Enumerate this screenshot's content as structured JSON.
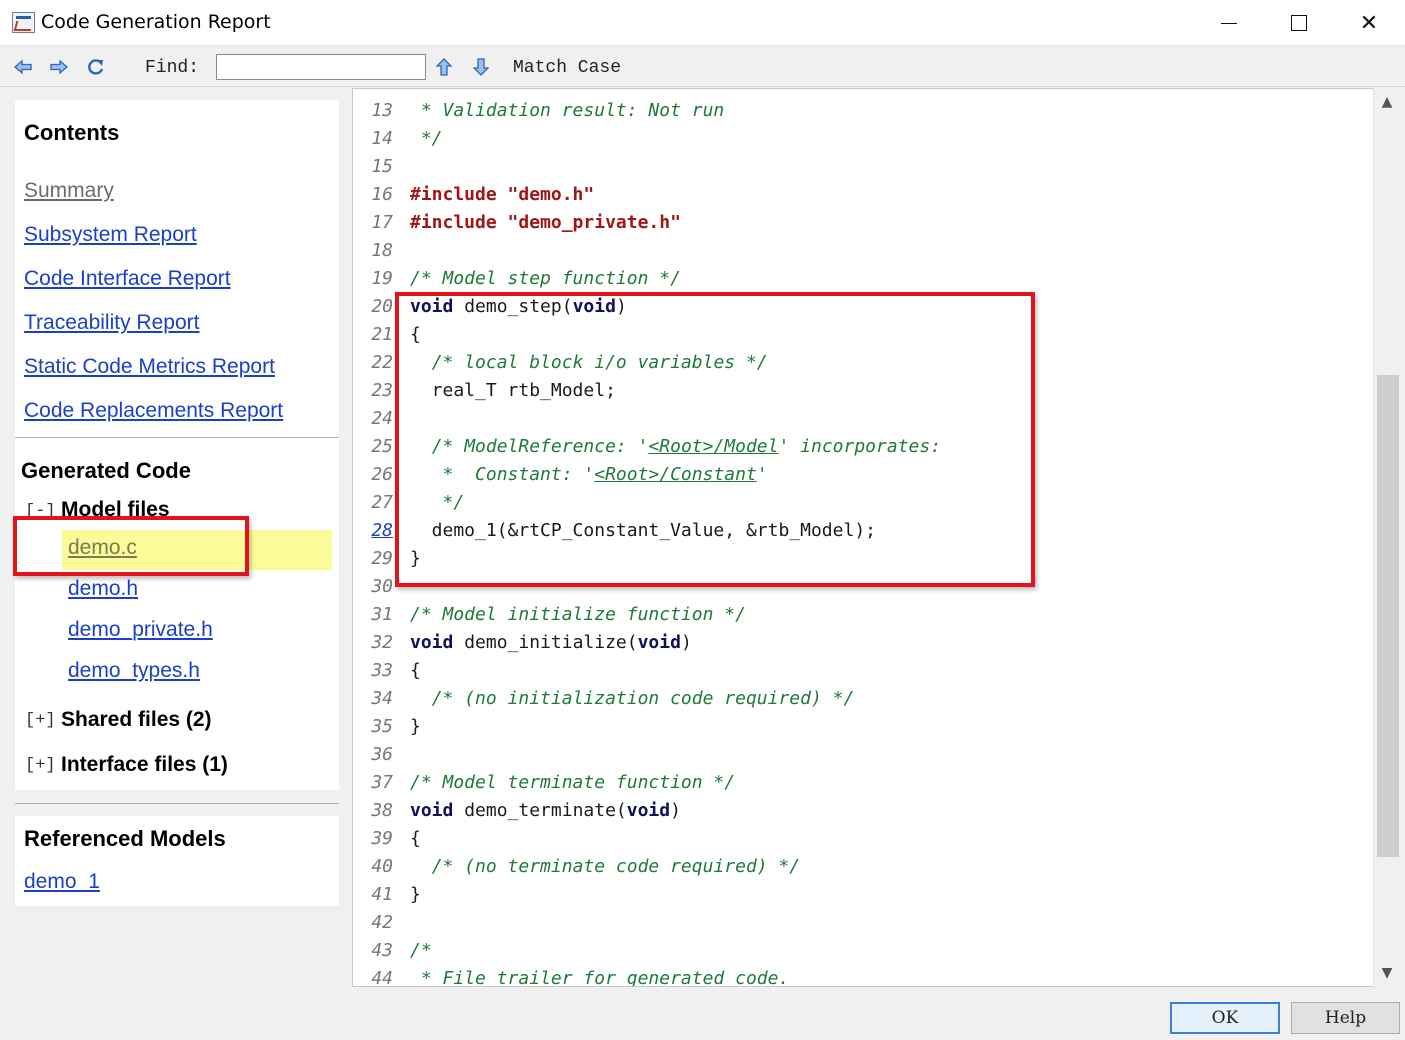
{
  "window": {
    "title": "Code Generation Report",
    "minimize": "minimize",
    "maximize": "maximize",
    "close": "✕"
  },
  "toolbar": {
    "back_icon": "back-arrow-icon",
    "forward_icon": "forward-arrow-icon",
    "refresh_icon": "refresh-icon",
    "find_label": "Find:",
    "find_value": "",
    "find_prev_icon": "up-arrow-icon",
    "find_next_icon": "down-arrow-icon",
    "match_case": "Match Case"
  },
  "sidebar": {
    "contents_title": "Contents",
    "contents_links": [
      "Summary",
      "Subsystem Report",
      "Code Interface Report",
      "Traceability Report",
      "Static Code Metrics Report",
      "Code Replacements Report"
    ],
    "generated_title": "Generated Code",
    "model_files_toggle": "[-]",
    "model_files_label": "Model files",
    "model_files": [
      "demo.c",
      "demo.h",
      "demo_private.h",
      "demo_types.h"
    ],
    "shared_toggle": "[+]",
    "shared_label": "Shared files (2)",
    "interface_toggle": "[+]",
    "interface_label": "Interface files (1)",
    "ref_title": "Referenced Models",
    "ref_links": [
      "demo_1"
    ]
  },
  "code": {
    "lines": [
      {
        "n": "13",
        "segs": [
          {
            "t": " * Validation result: Not run",
            "c": "cm"
          }
        ]
      },
      {
        "n": "14",
        "segs": [
          {
            "t": " */",
            "c": "cm"
          }
        ]
      },
      {
        "n": "15",
        "segs": []
      },
      {
        "n": "16",
        "segs": [
          {
            "t": "#include \"demo.h\"",
            "c": "pp"
          }
        ]
      },
      {
        "n": "17",
        "segs": [
          {
            "t": "#include \"demo_private.h\"",
            "c": "pp"
          }
        ]
      },
      {
        "n": "18",
        "segs": []
      },
      {
        "n": "19",
        "segs": [
          {
            "t": "/* Model step function */",
            "c": "cm"
          }
        ]
      },
      {
        "n": "20",
        "segs": [
          {
            "t": "void",
            "c": "kw"
          },
          {
            "t": " demo_step(",
            "c": ""
          },
          {
            "t": "void",
            "c": "kw"
          },
          {
            "t": ")",
            "c": ""
          }
        ]
      },
      {
        "n": "21",
        "segs": [
          {
            "t": "{",
            "c": ""
          }
        ]
      },
      {
        "n": "22",
        "segs": [
          {
            "t": "  ",
            "c": ""
          },
          {
            "t": "/* local block i/o variables */",
            "c": "cm"
          }
        ]
      },
      {
        "n": "23",
        "segs": [
          {
            "t": "  real_T rtb_Model;",
            "c": ""
          }
        ]
      },
      {
        "n": "24",
        "segs": []
      },
      {
        "n": "25",
        "segs": [
          {
            "t": "  ",
            "c": ""
          },
          {
            "t": "/* ModelReference: '",
            "c": "cm"
          },
          {
            "t": "<Root>/Model",
            "c": "cm-link"
          },
          {
            "t": "' incorporates:",
            "c": "cm"
          }
        ]
      },
      {
        "n": "26",
        "segs": [
          {
            "t": "   ",
            "c": ""
          },
          {
            "t": "*  Constant: '",
            "c": "cm"
          },
          {
            "t": "<Root>/Constant",
            "c": "cm-link"
          },
          {
            "t": "'",
            "c": "cm"
          }
        ]
      },
      {
        "n": "27",
        "segs": [
          {
            "t": "   ",
            "c": ""
          },
          {
            "t": "*/",
            "c": "cm"
          }
        ]
      },
      {
        "n": "28",
        "link": true,
        "segs": [
          {
            "t": "  demo_1(&rtCP_Constant_Value, &rtb_Model);",
            "c": ""
          }
        ]
      },
      {
        "n": "29",
        "segs": [
          {
            "t": "}",
            "c": ""
          }
        ]
      },
      {
        "n": "30",
        "segs": []
      },
      {
        "n": "31",
        "segs": [
          {
            "t": "/* Model initialize function */",
            "c": "cm"
          }
        ]
      },
      {
        "n": "32",
        "segs": [
          {
            "t": "void",
            "c": "kw"
          },
          {
            "t": " demo_initialize(",
            "c": ""
          },
          {
            "t": "void",
            "c": "kw"
          },
          {
            "t": ")",
            "c": ""
          }
        ]
      },
      {
        "n": "33",
        "segs": [
          {
            "t": "{",
            "c": ""
          }
        ]
      },
      {
        "n": "34",
        "segs": [
          {
            "t": "  ",
            "c": ""
          },
          {
            "t": "/* (no initialization code required) */",
            "c": "cm"
          }
        ]
      },
      {
        "n": "35",
        "segs": [
          {
            "t": "}",
            "c": ""
          }
        ]
      },
      {
        "n": "36",
        "segs": []
      },
      {
        "n": "37",
        "segs": [
          {
            "t": "/* Model terminate function */",
            "c": "cm"
          }
        ]
      },
      {
        "n": "38",
        "segs": [
          {
            "t": "void",
            "c": "kw"
          },
          {
            "t": " demo_terminate(",
            "c": ""
          },
          {
            "t": "void",
            "c": "kw"
          },
          {
            "t": ")",
            "c": ""
          }
        ]
      },
      {
        "n": "39",
        "segs": [
          {
            "t": "{",
            "c": ""
          }
        ]
      },
      {
        "n": "40",
        "segs": [
          {
            "t": "  ",
            "c": ""
          },
          {
            "t": "/* (no terminate code required) */",
            "c": "cm"
          }
        ]
      },
      {
        "n": "41",
        "segs": [
          {
            "t": "}",
            "c": ""
          }
        ]
      },
      {
        "n": "42",
        "segs": []
      },
      {
        "n": "43",
        "segs": [
          {
            "t": "/*",
            "c": "cm"
          }
        ]
      },
      {
        "n": "44",
        "segs": [
          {
            "t": " * File trailer for generated code.",
            "c": "cm"
          }
        ]
      }
    ]
  },
  "scroll": {
    "up_icon": "▲",
    "down_icon": "▼",
    "position": 0.35
  },
  "buttons": {
    "ok": "OK",
    "help": "Help"
  },
  "colors": {
    "link": "#1a3fc8",
    "comment": "#1f7a3a",
    "preprocessor": "#a01515",
    "keyword": "#101060",
    "highlight": "#fbfb9a",
    "annotation": "#e0141a"
  }
}
